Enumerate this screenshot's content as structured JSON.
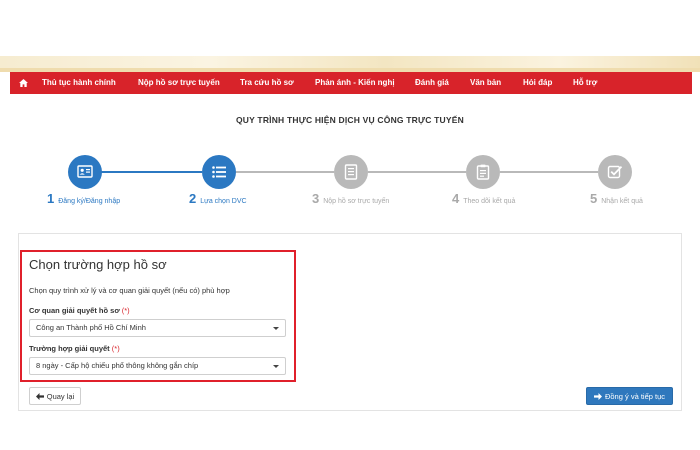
{
  "nav": {
    "home_icon": "home-icon",
    "items": [
      {
        "label": "Thủ tục hành chính"
      },
      {
        "label": "Nộp hồ sơ trực tuyến"
      },
      {
        "label": "Tra cứu hồ sơ"
      },
      {
        "label": "Phản ánh - Kiến nghị"
      },
      {
        "label": "Đánh giá"
      },
      {
        "label": "Văn bản"
      },
      {
        "label": "Hỏi đáp"
      },
      {
        "label": "Hỗ trợ"
      }
    ]
  },
  "page_title": "QUY TRÌNH THỰC HIỆN DỊCH VỤ CÔNG TRỰC TUYẾN",
  "steps": [
    {
      "number": "1",
      "label": "Đăng ký/Đăng nhập",
      "state": "done",
      "icon": "id-card-icon"
    },
    {
      "number": "2",
      "label": "Lựa chọn DVC",
      "state": "current",
      "icon": "list-icon"
    },
    {
      "number": "3",
      "label": "Nộp hồ sơ trực tuyến",
      "state": "pending",
      "icon": "document-icon"
    },
    {
      "number": "4",
      "label": "Theo dõi kết quả",
      "state": "pending",
      "icon": "clipboard-icon"
    },
    {
      "number": "5",
      "label": "Nhận kết quả",
      "state": "pending",
      "icon": "checkbox-icon"
    }
  ],
  "form": {
    "heading": "Chọn trường hợp hồ sơ",
    "description": "Chọn quy trình xử lý và cơ quan giải quyết (nếu có) phù hợp",
    "agency_label": "Cơ quan giải quyết hồ sơ",
    "agency_value": "Công an Thành phố Hồ Chí Minh",
    "case_label": "Trường hợp giải quyết",
    "case_value": "8 ngày - Cấp hộ chiếu phổ thông không gắn chíp",
    "required_mark": "(*)"
  },
  "buttons": {
    "back_label": "Quay lại",
    "next_label": "Đồng ý và tiếp tục"
  },
  "colors": {
    "nav_red": "#d8232a",
    "step_active": "#2b78c2",
    "step_inactive": "#b9b9b9",
    "primary_button": "#2f78bd",
    "highlight_border": "#e0202b"
  }
}
